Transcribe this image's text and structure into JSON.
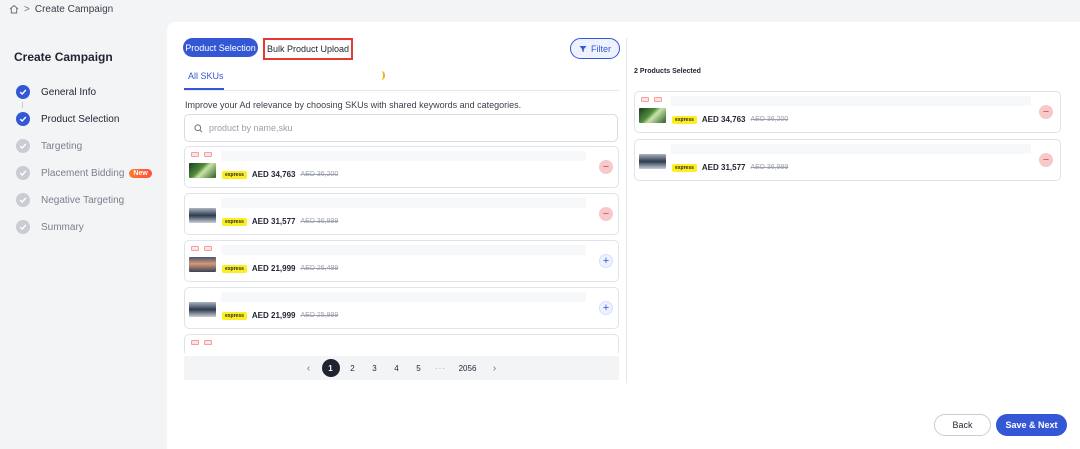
{
  "breadcrumb": {
    "home_icon": "home-icon",
    "separator": ">",
    "current": "Create Campaign"
  },
  "sidebar": {
    "title": "Create Campaign",
    "steps": [
      {
        "label": "General Info",
        "state": "done"
      },
      {
        "label": "Product Selection",
        "state": "done"
      },
      {
        "label": "Targeting",
        "state": "todo"
      },
      {
        "label": "Placement Bidding",
        "state": "todo",
        "badge": "New"
      },
      {
        "label": "Negative Targeting",
        "state": "todo"
      },
      {
        "label": "Summary",
        "state": "todo"
      }
    ]
  },
  "tabs": {
    "product_selection": "Product Selection",
    "bulk_upload": "Bulk Product Upload"
  },
  "filter": {
    "label": "Filter"
  },
  "subtabs": {
    "all_skus": "All SKUs"
  },
  "hint": "Improve your Ad relevance by choosing SKUs with shared keywords and categories.",
  "search": {
    "placeholder": "product by name,sku"
  },
  "products": [
    {
      "express": "express",
      "price": "AED 34,763",
      "old_price": "AED 36,200",
      "action": "−"
    },
    {
      "express": "express",
      "price": "AED 31,577",
      "old_price": "AED 36,999",
      "action": "−"
    },
    {
      "express": "express",
      "price": "AED 21,999",
      "old_price": "AED 26,499",
      "action": "+"
    },
    {
      "express": "express",
      "price": "AED 21,999",
      "old_price": "AED 25,999",
      "action": "+"
    }
  ],
  "pagination": {
    "pages": [
      "1",
      "2",
      "3",
      "4",
      "5"
    ],
    "dots": "···",
    "last": "2056",
    "prev": "‹",
    "next": "›",
    "current": "1"
  },
  "selected": {
    "title": "2 Products Selected",
    "items": [
      {
        "express": "express",
        "price": "AED 34,763",
        "old_price": "AED 36,200",
        "action": "−"
      },
      {
        "express": "express",
        "price": "AED 31,577",
        "old_price": "AED 36,999",
        "action": "−"
      }
    ]
  },
  "footer": {
    "back": "Back",
    "next": "Save & Next"
  },
  "colors": {
    "primary": "#3457d5",
    "remove": "#d2484f",
    "highlight_border": "#e53935",
    "express": "#fcee21"
  }
}
